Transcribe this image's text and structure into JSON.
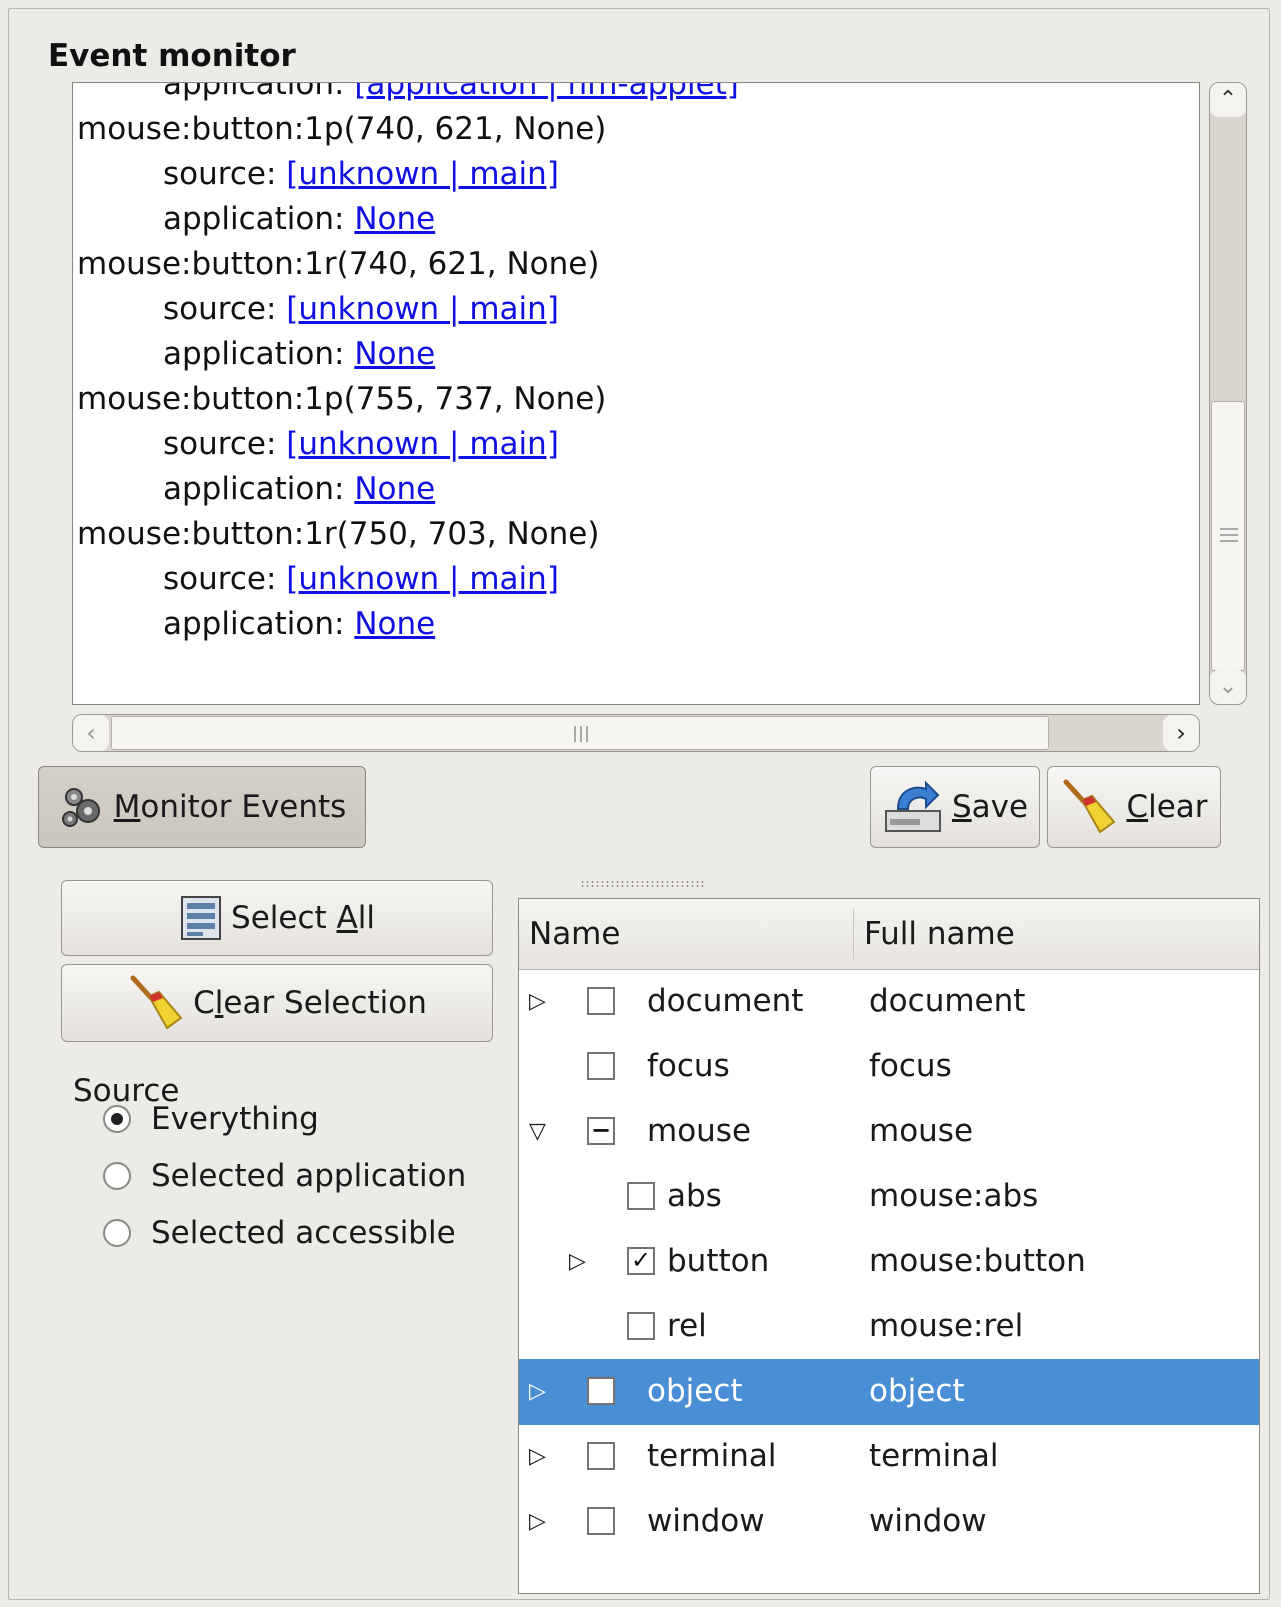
{
  "panel": {
    "title": "Event monitor"
  },
  "log": {
    "lines": [
      {
        "indent": true,
        "label": "application: ",
        "link": "[application | nm-applet]"
      },
      {
        "indent": false,
        "text": "mouse:button:1p(740, 621, None)"
      },
      {
        "indent": true,
        "label": "source: ",
        "link": "[unknown | main]"
      },
      {
        "indent": true,
        "label": "application: ",
        "link": "None"
      },
      {
        "indent": false,
        "text": "mouse:button:1r(740, 621, None)"
      },
      {
        "indent": true,
        "label": "source: ",
        "link": "[unknown | main]"
      },
      {
        "indent": true,
        "label": "application: ",
        "link": "None"
      },
      {
        "indent": false,
        "text": "mouse:button:1p(755, 737, None)"
      },
      {
        "indent": true,
        "label": "source: ",
        "link": "[unknown | main]"
      },
      {
        "indent": true,
        "label": "application: ",
        "link": "None"
      },
      {
        "indent": false,
        "text": "mouse:button:1r(750, 703, None)"
      },
      {
        "indent": true,
        "label": "source: ",
        "link": "[unknown | main]"
      },
      {
        "indent": true,
        "label": "application: ",
        "link": "None"
      }
    ],
    "link_color": "#1010e0"
  },
  "toolbar": {
    "monitor_pre": "",
    "monitor_mn": "M",
    "monitor_post": "onitor Events",
    "save_mn": "S",
    "save_post": "ave",
    "clear_mn": "C",
    "clear_post": "lear"
  },
  "selection": {
    "select_all_pre": "Select ",
    "select_all_mn": "A",
    "select_all_post": "ll",
    "clear_sel_pre": "C",
    "clear_sel_mn": "l",
    "clear_sel_post": "ear Selection"
  },
  "source": {
    "label": "Source",
    "options": [
      "Everything",
      "Selected application",
      "Selected accessible"
    ],
    "selected": "Everything"
  },
  "tree": {
    "columns": [
      "Name",
      "Full name"
    ],
    "selected_color": "#4a8fd6",
    "rows": [
      {
        "name": "document",
        "full": "document",
        "level": 0,
        "expander": "collapsed",
        "check": "off"
      },
      {
        "name": "focus",
        "full": "focus",
        "level": 0,
        "expander": "none",
        "check": "off"
      },
      {
        "name": "mouse",
        "full": "mouse",
        "level": 0,
        "expander": "expanded",
        "check": "mixed"
      },
      {
        "name": "abs",
        "full": "mouse:abs",
        "level": 1,
        "expander": "none",
        "check": "off"
      },
      {
        "name": "button",
        "full": "mouse:button",
        "level": 1,
        "expander": "collapsed",
        "check": "on"
      },
      {
        "name": "rel",
        "full": "mouse:rel",
        "level": 1,
        "expander": "none",
        "check": "off"
      },
      {
        "name": "object",
        "full": "object",
        "level": 0,
        "expander": "collapsed",
        "check": "off",
        "selected": true
      },
      {
        "name": "terminal",
        "full": "terminal",
        "level": 0,
        "expander": "collapsed",
        "check": "off"
      },
      {
        "name": "window",
        "full": "window",
        "level": 0,
        "expander": "collapsed",
        "check": "off"
      }
    ]
  },
  "icons": {
    "monitor": "gears-icon",
    "save": "save-disk-icon",
    "clear": "broom-icon",
    "select_all": "select-all-icon"
  }
}
